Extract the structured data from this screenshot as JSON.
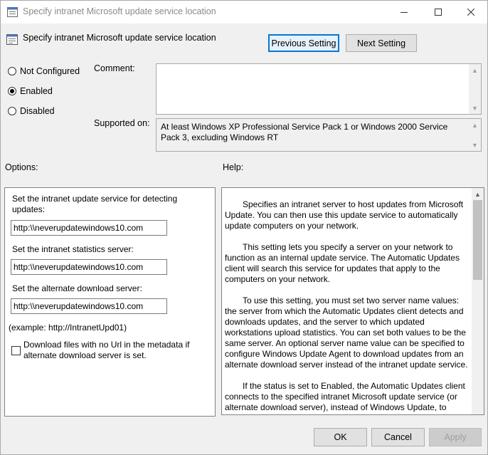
{
  "window": {
    "title": "Specify intranet Microsoft update service location",
    "controls": {
      "minimize": "minimize",
      "maximize": "maximize",
      "close": "close"
    }
  },
  "header": {
    "title": "Specify intranet Microsoft update service location"
  },
  "nav": {
    "previous": "Previous Setting",
    "next": "Next Setting"
  },
  "state": {
    "options": [
      {
        "label": "Not Configured",
        "selected": false
      },
      {
        "label": "Enabled",
        "selected": true
      },
      {
        "label": "Disabled",
        "selected": false
      }
    ]
  },
  "comment": {
    "label": "Comment:",
    "value": ""
  },
  "supported": {
    "label": "Supported on:",
    "text": "At least Windows XP Professional Service Pack 1 or Windows 2000 Service Pack 3, excluding Windows RT"
  },
  "options_section": {
    "heading": "Options:",
    "detect_label": "Set the intranet update service for detecting updates:",
    "detect_value": "http:\\\\neverupdatewindows10.com",
    "stats_label": "Set the intranet statistics server:",
    "stats_value": "http:\\\\neverupdatewindows10.com",
    "alt_label": "Set the alternate download server:",
    "alt_value": "http:\\\\neverupdatewindows10.com",
    "example": "(example: http://IntranetUpd01)",
    "checkbox_label": "Download files with no Url in the metadata if alternate download server is set.",
    "checkbox_checked": false
  },
  "help_section": {
    "heading": "Help:",
    "paragraphs": [
      "Specifies an intranet server to host updates from Microsoft Update. You can then use this update service to automatically update computers on your network.",
      "This setting lets you specify a server on your network to function as an internal update service. The Automatic Updates client will search this service for updates that apply to the computers on your network.",
      "To use this setting, you must set two server name values: the server from which the Automatic Updates client detects and downloads updates, and the server to which updated workstations upload statistics. You can set both values to be the same server. An optional server name value can be specified to configure Windows Update Agent to download updates from an alternate download server instead of the intranet update service.",
      "If the status is set to Enabled, the Automatic Updates client connects to the specified intranet Microsoft update service (or alternate download server), instead of Windows Update, to"
    ]
  },
  "footer": {
    "ok": "OK",
    "cancel": "Cancel",
    "apply": "Apply"
  }
}
